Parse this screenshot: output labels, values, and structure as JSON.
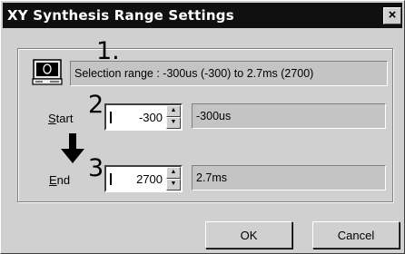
{
  "window": {
    "title": "XY Synthesis Range Settings",
    "close_glyph": "×"
  },
  "selection": {
    "step_number": "1.",
    "icon": "monitor-icon",
    "text": "Selection range : -300us (-300) to 2.7ms (2700)"
  },
  "start": {
    "step_number": "2.",
    "label_accel": "S",
    "label_rest": "tart",
    "value": "-300",
    "display": "-300us"
  },
  "end": {
    "step_number": "3.",
    "label_accel": "E",
    "label_rest": "nd",
    "value": "2700",
    "display": "2.7ms"
  },
  "buttons": {
    "ok": "OK",
    "cancel": "Cancel"
  }
}
